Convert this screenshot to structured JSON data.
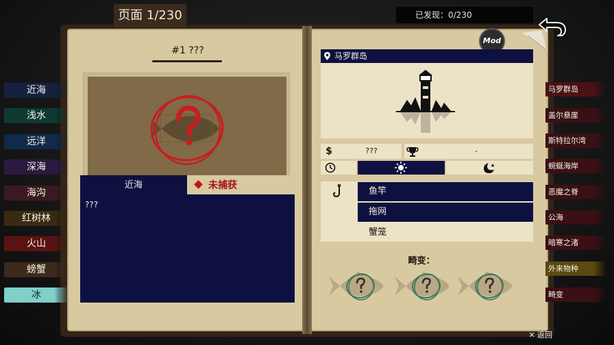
{
  "header": {
    "page_label": "页面 1/230",
    "discovered": "已发现：0/230"
  },
  "left_categories": [
    {
      "label": "近海",
      "color": "#15213f"
    },
    {
      "label": "浅水",
      "color": "#0e3a33"
    },
    {
      "label": "远洋",
      "color": "#0f2a4a"
    },
    {
      "label": "深海",
      "color": "#2b1a3f"
    },
    {
      "label": "海沟",
      "color": "#3a1a20"
    },
    {
      "label": "红树林",
      "color": "#3a2a12"
    },
    {
      "label": "火山",
      "color": "#5a1212"
    },
    {
      "label": "螃蟹",
      "color": "#3d2a1a"
    },
    {
      "label": "冰",
      "color": "#7fd0c8"
    }
  ],
  "left_selected_index": 8,
  "right_categories": [
    {
      "label": "马罗群岛",
      "color": "#4a1216"
    },
    {
      "label": "盖尔悬崖",
      "color": "#3a1014"
    },
    {
      "label": "斯特拉尔湾",
      "color": "#3a1014"
    },
    {
      "label": "蜿蜒海岸",
      "color": "#3a1014"
    },
    {
      "label": "恶魔之脊",
      "color": "#3a1014"
    },
    {
      "label": "公海",
      "color": "#3a1014"
    },
    {
      "label": "暗寒之渚",
      "color": "#3a1014"
    },
    {
      "label": "外来物种",
      "color": "#5a4a10"
    },
    {
      "label": "畸变",
      "color": "#3a1014"
    }
  ],
  "fish": {
    "title": "#1 ???",
    "location": "近海",
    "status": "未捕获",
    "description": "???",
    "region": "马罗群岛",
    "price": "???",
    "record": "-",
    "gear": [
      "鱼竿",
      "拖网",
      "蟹笼"
    ],
    "gear_active": [
      true,
      true,
      false
    ],
    "aberrations_label": "畸变：",
    "time_selected": "day"
  },
  "icons": {
    "back": "curved-back-arrow-icon",
    "close": "close-x-icon",
    "price": "dollar-icon",
    "record": "trophy-icon",
    "clock": "clock-icon",
    "day": "sun-icon",
    "night": "moon-icon",
    "gear": "fishing-hook-icon",
    "region": "location-pin-icon"
  },
  "colors": {
    "page": "#d9c9a1",
    "ink_panel": "#0e1140",
    "status_red": "#a21414",
    "unknown_circle": "#c81e1e"
  },
  "mod_badge": "Mod",
  "footer": {
    "return_label": "返回"
  }
}
